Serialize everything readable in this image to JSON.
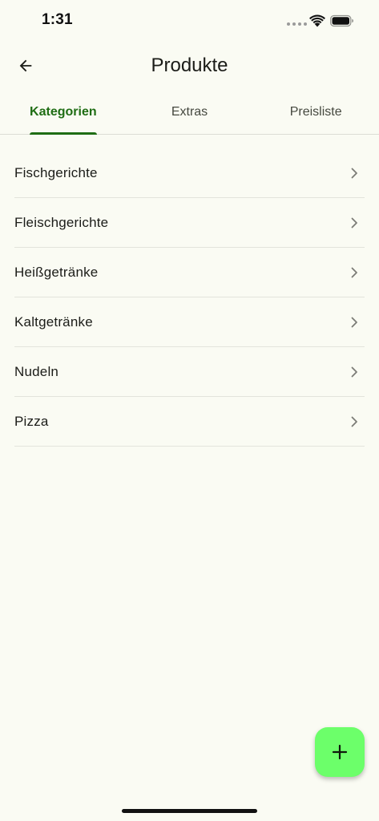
{
  "status_bar": {
    "time": "1:31"
  },
  "app_bar": {
    "title": "Produkte",
    "back_icon": "arrow-left-icon"
  },
  "tabs": [
    {
      "label": "Kategorien",
      "active": true
    },
    {
      "label": "Extras",
      "active": false
    },
    {
      "label": "Preisliste",
      "active": false
    }
  ],
  "categories": [
    {
      "label": "Fischgerichte"
    },
    {
      "label": "Fleischgerichte"
    },
    {
      "label": "Heißgetränke"
    },
    {
      "label": "Kaltgetränke"
    },
    {
      "label": "Nudeln"
    },
    {
      "label": "Pizza"
    }
  ],
  "fab": {
    "icon": "plus-icon"
  },
  "colors": {
    "background": "#fafbf3",
    "accent": "#1f6d14",
    "fab": "#6cff6a",
    "divider": "#e3e4dc"
  }
}
